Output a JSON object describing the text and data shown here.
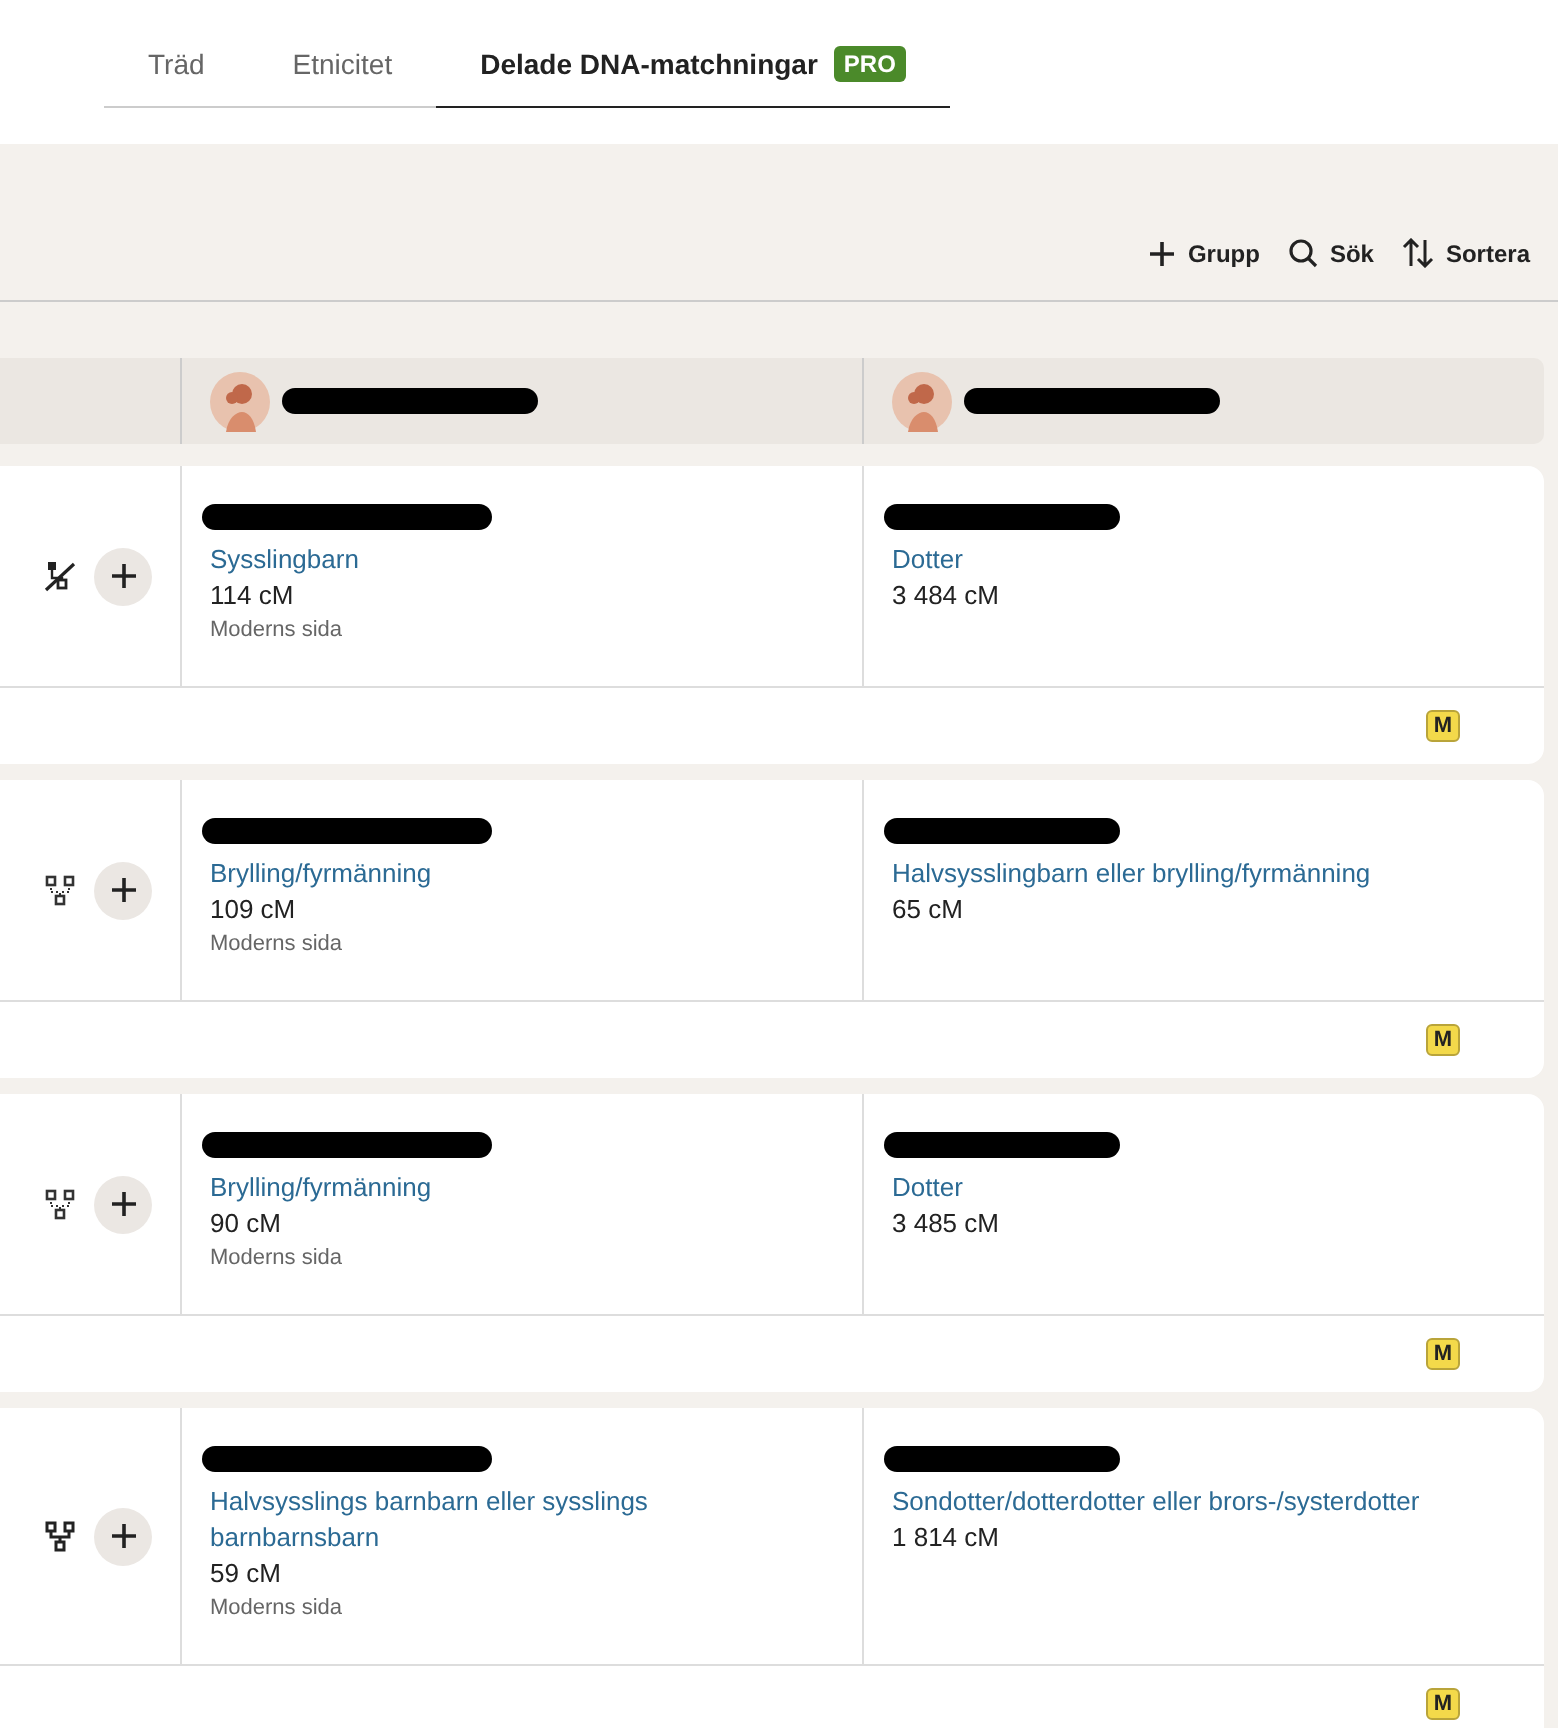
{
  "tabs": [
    {
      "label": "Träd",
      "selected": false
    },
    {
      "label": "Etnicitet",
      "selected": false
    },
    {
      "label": "Delade DNA-matchningar",
      "selected": true,
      "badge": "PRO"
    }
  ],
  "toolbar": [
    {
      "kind": "add",
      "label": "Grupp"
    },
    {
      "kind": "search",
      "label": "Sök"
    },
    {
      "kind": "sort",
      "label": "Sortera"
    }
  ],
  "matches": [
    {
      "kind": "unlinked",
      "cells": [
        {
          "relationship": "Sysslingbarn",
          "shared": "114 cM",
          "side": "Moderns sida"
        },
        {
          "relationship": "Dotter",
          "shared": "3 484 cM"
        }
      ],
      "badge": "M"
    },
    {
      "kind": "partial",
      "cells": [
        {
          "relationship": "Brylling/fyrmänning",
          "shared": "109 cM",
          "side": "Moderns sida"
        },
        {
          "relationship": "Halvsysslingbarn eller brylling/fyrmänning",
          "shared": "65 cM"
        }
      ],
      "badge": "M"
    },
    {
      "kind": "partial",
      "cells": [
        {
          "relationship": "Brylling/fyrmänning",
          "shared": "90 cM",
          "side": "Moderns sida"
        },
        {
          "relationship": "Dotter",
          "shared": "3 485 cM"
        }
      ],
      "badge": "M"
    },
    {
      "kind": "linked",
      "cells": [
        {
          "relationship": "Halvsysslings barnbarn eller sysslings barnbarnsbarn",
          "shared": "59 cM",
          "side": "Moderns sida"
        },
        {
          "relationship": "Sondotter/dotterdotter eller brors-/systerdotter",
          "shared": "1 814 cM"
        }
      ],
      "badge": "M"
    }
  ]
}
